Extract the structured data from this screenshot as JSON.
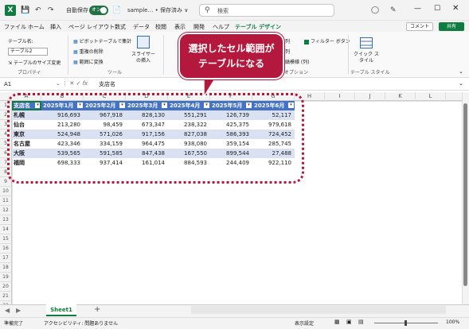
{
  "titlebar": {
    "app_icon": "X",
    "autosave_label": "自動保存",
    "autosave_state": "オン",
    "filename": "sample… • 保存済み ∨",
    "search_placeholder": "検索"
  },
  "menu": {
    "items": [
      "ファイル",
      "ホーム",
      "挿入",
      "ページ レイアウト",
      "数式",
      "データ",
      "校閲",
      "表示",
      "開発",
      "ヘルプ",
      "テーブル デザイン"
    ],
    "comment": "コメント",
    "share": "共有"
  },
  "ribbon": {
    "table_name_label": "テーブル名:",
    "table_name_value": "テーブル2",
    "resize": "テーブルのサイズ変更",
    "props_group": "プロパティ",
    "pivot": "ピボットテーブルで集計",
    "dedupe": "重複の削除",
    "convert": "範囲に変換",
    "slicer": "スライサーの挿入",
    "tools_group": "ツール",
    "first_col": "列",
    "filter_btn": "フィルター ボタン",
    "col2": "列",
    "banded": "縞模様 (列)",
    "style_opts": "ルのオプション",
    "quick_style": "クイック スタイル",
    "style_group": "テーブル スタイル"
  },
  "formula": {
    "namebox": "A1",
    "content": "支店名"
  },
  "columns": [
    "A",
    "B",
    "C",
    "D",
    "E",
    "F",
    "G",
    "H",
    "I",
    "J",
    "K",
    "L"
  ],
  "rows": [
    "1",
    "2",
    "3",
    "4",
    "5",
    "6",
    "7",
    "8",
    "9",
    "10",
    "11",
    "12",
    "13",
    "14",
    "15",
    "16",
    "17",
    "18",
    "19",
    "20",
    "21",
    "22"
  ],
  "table": {
    "headers": [
      "支店名",
      "2025年1月",
      "2025年2月",
      "2025年3月",
      "2025年4月",
      "2025年5月",
      "2025年6月"
    ],
    "data": [
      [
        "札幌",
        "916,693",
        "967,918",
        "828,130",
        "551,291",
        "126,739",
        "52,117"
      ],
      [
        "仙台",
        "213,280",
        "98,459",
        "673,347",
        "238,322",
        "425,375",
        "979,618"
      ],
      [
        "東京",
        "524,948",
        "571,026",
        "917,156",
        "827,038",
        "586,393",
        "724,452"
      ],
      [
        "名古屋",
        "423,346",
        "334,159",
        "964,475",
        "938,080",
        "359,154",
        "285,745"
      ],
      [
        "大阪",
        "539,565",
        "591,585",
        "847,438",
        "167,550",
        "899,544",
        "27,488"
      ],
      [
        "福岡",
        "698,333",
        "937,414",
        "161,014",
        "884,593",
        "244,409",
        "922,110"
      ]
    ]
  },
  "sheet": {
    "tab": "Sheet1",
    "add": "+"
  },
  "status": {
    "ready": "準備完了",
    "accessibility": "アクセシビリティ: 問題ありません",
    "display": "表示設定",
    "zoom": "100%"
  },
  "callout": {
    "line1": "選択したセル範囲が",
    "line2": "テーブルになる"
  },
  "colors": {
    "excel_green": "#107c41",
    "table_header": "#4472c4",
    "band": "#d9e1f2",
    "callout": "#b4183d"
  }
}
